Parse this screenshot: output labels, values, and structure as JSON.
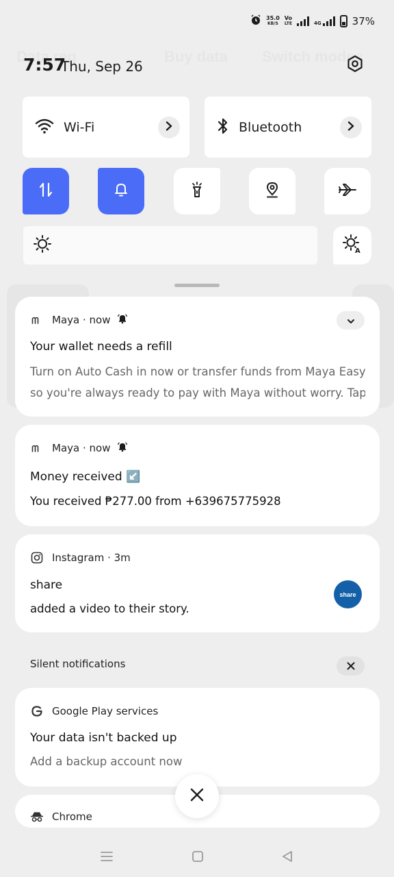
{
  "background_app": {
    "ghost_labels": [
      "Data reg",
      "Buy data",
      "Switch modes"
    ]
  },
  "status_bar": {
    "speed_value": "35.0",
    "speed_unit": "KB/S",
    "volte_top": "Vo",
    "volte_bottom": "LTE",
    "network_type": "4G",
    "battery_percent": "37%",
    "battery_level": 0.37
  },
  "header": {
    "time": "7:57",
    "date": "Thu, Sep 26"
  },
  "quick_settings": {
    "wifi_label": "Wi-Fi",
    "bluetooth_label": "Bluetooth",
    "toggles": [
      {
        "name": "mobile-data",
        "on": true
      },
      {
        "name": "sound",
        "on": true
      },
      {
        "name": "flashlight",
        "on": false
      },
      {
        "name": "location",
        "on": false
      },
      {
        "name": "airplane-mode",
        "on": false
      }
    ],
    "accent_color": "#4a6cf7"
  },
  "notifications": [
    {
      "app": "Maya · now",
      "title": "Your wallet needs a refill",
      "body_line1": "Turn on Auto Cash in now or transfer funds from Maya Easy Credit",
      "body_line2": "so you're always ready to pay with Maya without worry. Tap to s⋯"
    },
    {
      "app": "Maya · now",
      "title": "Money received ↙️",
      "body": "You received ₱277.00 from +639675775928"
    },
    {
      "app": "Instagram · 3m",
      "title": "share",
      "body": "added a video to their story.",
      "avatar_text": "share",
      "avatar_color": "#1460a8"
    }
  ],
  "silent": {
    "label": "Silent notifications",
    "items": [
      {
        "app": "Google Play services",
        "title": "Your data isn't backed up",
        "body": "Add a backup account now"
      },
      {
        "app": "Chrome"
      }
    ]
  }
}
